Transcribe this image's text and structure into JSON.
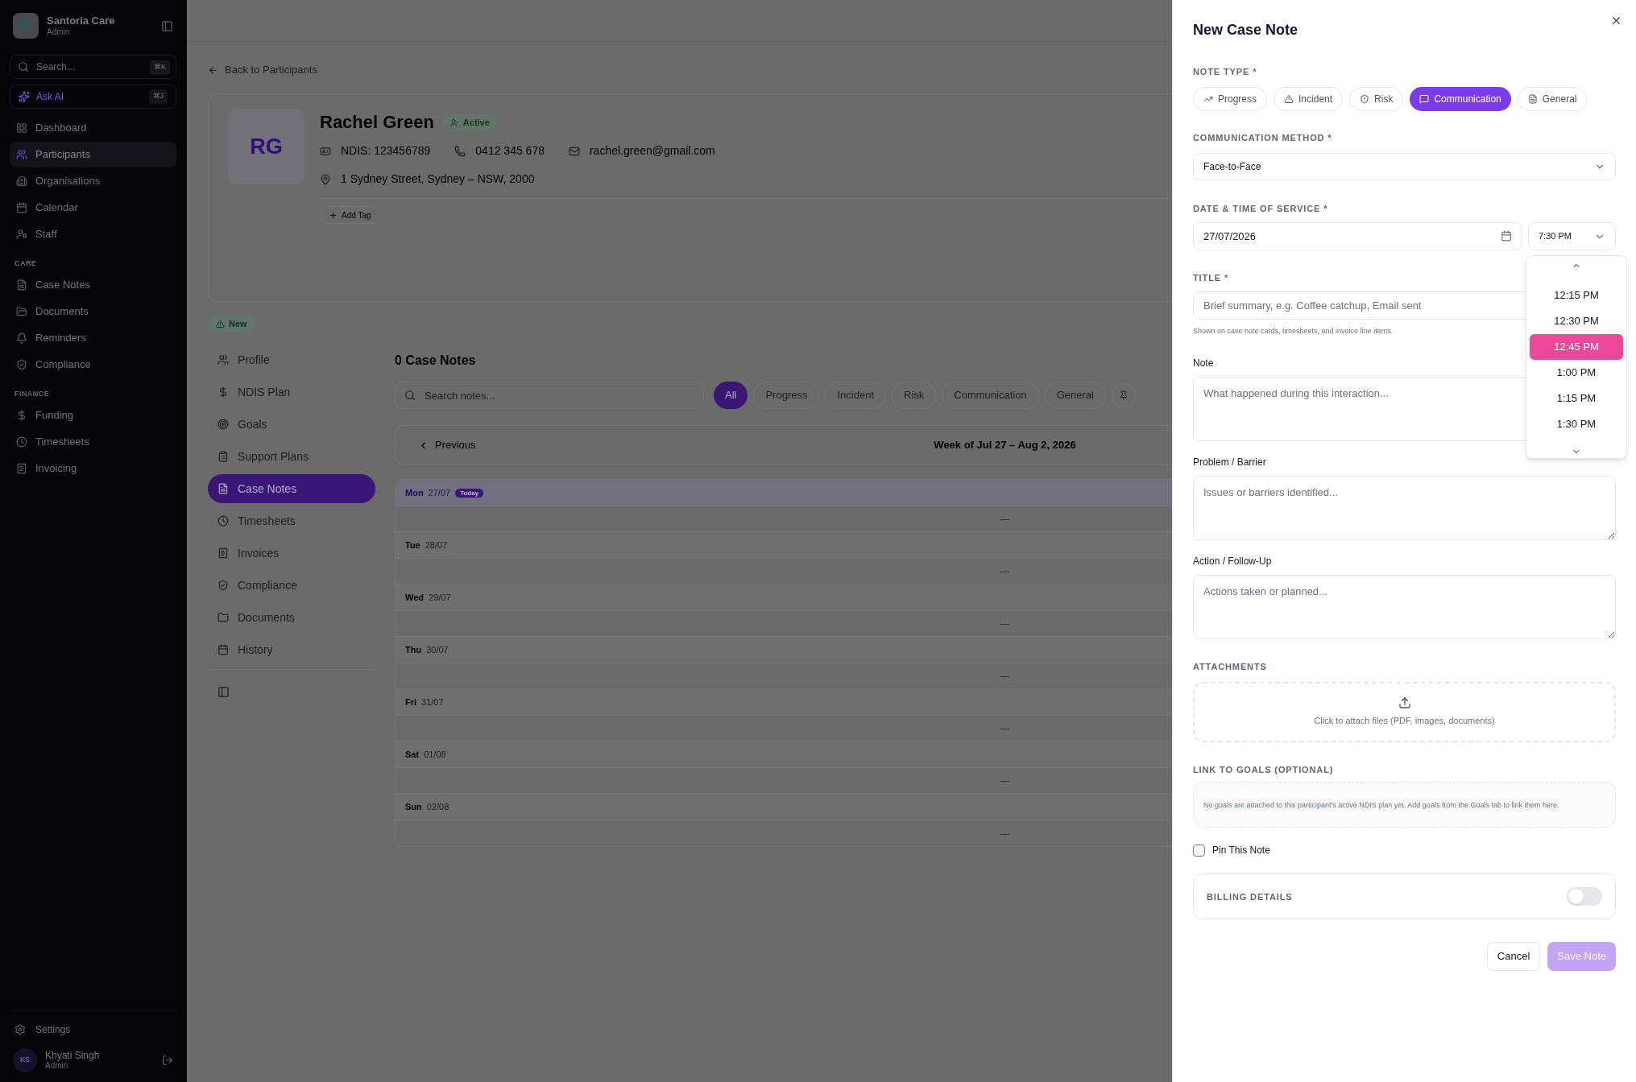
{
  "sidebar": {
    "brand": {
      "name": "Santoria Care",
      "role": "Admin"
    },
    "search": {
      "placeholder": "Search...",
      "shortcut": "⌘K"
    },
    "ask_ai": {
      "label": "Ask AI",
      "shortcut": "⌘J"
    },
    "sections": [
      {
        "items": [
          {
            "label": "Dashboard",
            "selected": false
          },
          {
            "label": "Participants",
            "selected": true
          },
          {
            "label": "Organisations",
            "selected": false
          },
          {
            "label": "Calendar",
            "selected": false
          },
          {
            "label": "Staff",
            "selected": false
          }
        ]
      },
      {
        "heading": "CARE",
        "items": [
          {
            "label": "Case Notes",
            "selected": false
          },
          {
            "label": "Documents",
            "selected": false
          },
          {
            "label": "Reminders",
            "selected": false
          },
          {
            "label": "Compliance",
            "selected": false
          }
        ]
      },
      {
        "heading": "FINANCE",
        "items": [
          {
            "label": "Funding",
            "selected": false
          },
          {
            "label": "Timesheets",
            "selected": false
          },
          {
            "label": "Invoicing",
            "selected": false
          }
        ]
      }
    ],
    "settings": "Settings",
    "user": {
      "initials": "KS",
      "name": "Khyati Singh",
      "role": "Admin"
    }
  },
  "main": {
    "back_link": "Back to Participants",
    "participant": {
      "initials": "RG",
      "name": "Rachel Green",
      "status": "Active",
      "ndis": "NDIS: 123456789",
      "phone": "0412 345 678",
      "email": "rachel.green@gmail.com",
      "address": "1 Sydney Street, Sydney – NSW, 2000",
      "add_tag": "Add Tag"
    },
    "badge": "New",
    "subnav": [
      {
        "label": "Profile",
        "selected": false
      },
      {
        "label": "NDIS Plan",
        "selected": false
      },
      {
        "label": "Goals",
        "selected": false
      },
      {
        "label": "Support Plans",
        "selected": false
      },
      {
        "label": "Case Notes",
        "selected": true
      },
      {
        "label": "Timesheets",
        "selected": false
      },
      {
        "label": "Invoices",
        "selected": false
      },
      {
        "label": "Compliance",
        "selected": false
      },
      {
        "label": "Documents",
        "selected": false
      },
      {
        "label": "History",
        "selected": false
      }
    ],
    "case_notes": {
      "heading": "0 Case Notes",
      "search": {
        "placeholder": "Search notes..."
      },
      "filters": [
        {
          "label": "All",
          "selected": true
        },
        {
          "label": "Progress",
          "selected": false
        },
        {
          "label": "Incident",
          "selected": false
        },
        {
          "label": "Risk",
          "selected": false
        },
        {
          "label": "Communication",
          "selected": false
        },
        {
          "label": "General",
          "selected": false
        }
      ],
      "week": {
        "previous": "Previous",
        "label": "Week of Jul 27 – Aug 2, 2026"
      },
      "days": [
        {
          "day": "Mon",
          "date": "27/07",
          "today": true,
          "badge": "Today",
          "empty": "—"
        },
        {
          "day": "Tue",
          "date": "28/07",
          "today": false,
          "empty": "—"
        },
        {
          "day": "Wed",
          "date": "29/07",
          "today": false,
          "empty": "—"
        },
        {
          "day": "Thu",
          "date": "30/07",
          "today": false,
          "empty": "—"
        },
        {
          "day": "Fri",
          "date": "31/07",
          "today": false,
          "empty": "—"
        },
        {
          "day": "Sat",
          "date": "01/08",
          "today": false,
          "empty": "—"
        },
        {
          "day": "Sun",
          "date": "02/08",
          "today": false,
          "empty": "—"
        }
      ]
    }
  },
  "drawer": {
    "title": "New Case Note",
    "note_type": {
      "label": "NOTE TYPE *",
      "options": [
        {
          "label": "Progress",
          "selected": false
        },
        {
          "label": "Incident",
          "selected": false
        },
        {
          "label": "Risk",
          "selected": false
        },
        {
          "label": "Communication",
          "selected": true
        },
        {
          "label": "General",
          "selected": false
        }
      ]
    },
    "communication_method": {
      "label": "COMMUNICATION METHOD *",
      "value": "Face-to-Face"
    },
    "date_time": {
      "label": "DATE & TIME OF SERVICE *",
      "date": "27/07/2026",
      "time": "7:30 PM",
      "time_options": [
        {
          "label": "12:15 PM",
          "selected": false
        },
        {
          "label": "12:30 PM",
          "selected": false
        },
        {
          "label": "12:45 PM",
          "selected": true
        },
        {
          "label": "1:00 PM",
          "selected": false
        },
        {
          "label": "1:15 PM",
          "selected": false
        },
        {
          "label": "1:30 PM",
          "selected": false
        }
      ]
    },
    "title_field": {
      "label": "TITLE *",
      "placeholder": "Brief summary, e.g. Coffee catchup, Email sent",
      "hint": "Shown on case note cards, timesheets, and invoice line items."
    },
    "text_areas": [
      {
        "label": "Note",
        "placeholder": "What happened during this interaction..."
      },
      {
        "label": "Problem / Barrier",
        "placeholder": "Issues or barriers identified..."
      },
      {
        "label": "Action / Follow-Up",
        "placeholder": "Actions taken or planned..."
      }
    ],
    "attachments": {
      "label": "ATTACHMENTS",
      "text": "Click to attach files (PDF, images, documents)"
    },
    "goals": {
      "label": "LINK TO GOALS (OPTIONAL)",
      "text": "No goals are attached to this participant's active NDIS plan yet. Add goals from the Goals tab to link them here."
    },
    "pin": {
      "label": "Pin This Note",
      "checked": false
    },
    "billing": {
      "label": "BILLING DETAILS",
      "on": false
    },
    "buttons": {
      "cancel": "Cancel",
      "save": "Save Note",
      "save_disabled": true
    }
  }
}
